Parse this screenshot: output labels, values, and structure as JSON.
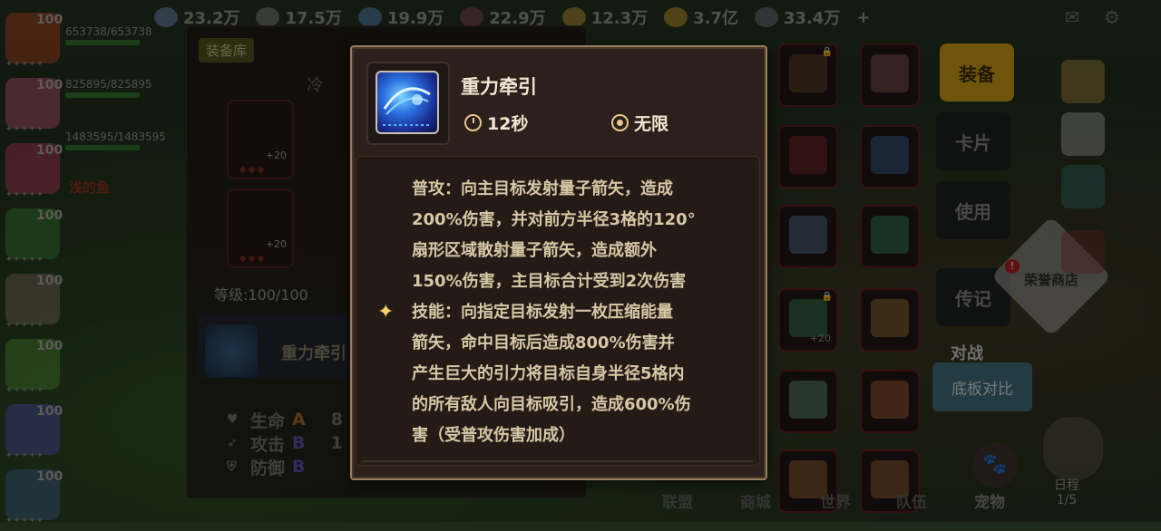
{
  "resources": [
    {
      "value": "23.2万",
      "color": "#7f93c6"
    },
    {
      "value": "17.5万",
      "color": "#8c8c8c"
    },
    {
      "value": "19.9万",
      "color": "#5f8fc6"
    },
    {
      "value": "22.9万",
      "color": "#8a4c5e"
    },
    {
      "value": "12.3万",
      "color": "#c9a23a"
    },
    {
      "value": "3.7亿",
      "color": "#d2a62e"
    },
    {
      "value": "33.4万",
      "color": "#7a7a88"
    }
  ],
  "add_symbol": "+",
  "heroes": [
    {
      "level": "100",
      "color": "#c74a2c"
    },
    {
      "level": "100",
      "color": "#d45a86"
    },
    {
      "level": "100",
      "color": "#c63e6a"
    },
    {
      "level": "100",
      "color": "#3e8c3a"
    },
    {
      "level": "100",
      "color": "#8a7a6a"
    },
    {
      "level": "100",
      "color": "#5a9a3a"
    },
    {
      "level": "100",
      "color": "#5a5ac0"
    },
    {
      "level": "100",
      "color": "#4a6a9a"
    }
  ],
  "hero_stars": "✦✦✦✦✦",
  "hp": [
    "653738/653738",
    "825895/825895",
    "1483595/1483595"
  ],
  "hero_red_name": "浅的鱼",
  "library": {
    "tab": "装备库",
    "frag_left": "冷",
    "plus_label": "+20",
    "level_text": "等级:100/100",
    "skill_name": "重力牵引",
    "stats": [
      {
        "icon": "♥",
        "label": "生命",
        "grade": "A",
        "value": "8"
      },
      {
        "icon": "➶",
        "label": "攻击",
        "grade": "B",
        "value": "1"
      },
      {
        "icon": "⛨",
        "label": "防御",
        "grade": "B",
        "value": ""
      }
    ]
  },
  "menu": {
    "equip": "装备",
    "card": "卡片",
    "use": "使用",
    "legend": "传记",
    "vs": "对战",
    "compare": "底板对比",
    "honor_shop": "荣誉商店",
    "honor_badge": "!"
  },
  "bottom_nav": [
    "联盟",
    "商城",
    "世界",
    "队伍",
    "宠物"
  ],
  "schedule": {
    "label": "日程",
    "page": "1/5"
  },
  "tooltip": {
    "title": "重力牵引",
    "cooldown": "12秒",
    "range": "无限",
    "lines": [
      "普攻：向主目标发射量子箭矢，造成",
      "200%伤害，并对前方半径3格的120°",
      "扇形区域散射量子箭矢，造成额外",
      "150%伤害，主目标合计受到2次伤害",
      "技能：向指定目标发射一枚压缩能量",
      "箭矢，命中目标后造成800%伤害并",
      "产生巨大的引力将目标自身半径5格内",
      "的所有敌人向目标吸引，造成600%伤",
      "害（受普攻伤害加成）"
    ],
    "star": "✦"
  }
}
